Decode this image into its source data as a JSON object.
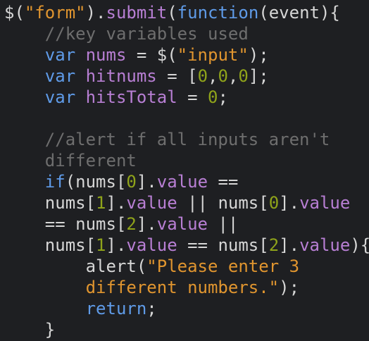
{
  "editor": {
    "language": "javascript",
    "colors": {
      "background": "#1e1f22",
      "string": "#e0952f",
      "function": "#b87fd4",
      "keyword": "#5f9be8",
      "number": "#8fa31a",
      "comment": "#6e6e6e",
      "plain": "#d6d6d6"
    },
    "lines": [
      [
        [
          "$(",
          "plain"
        ],
        [
          "\"form\"",
          "str"
        ],
        [
          ").",
          "plain"
        ],
        [
          "submit",
          "fn"
        ],
        [
          "(",
          "plain"
        ],
        [
          "function",
          "kw"
        ],
        [
          "(event){",
          "plain"
        ]
      ],
      [
        [
          "    ",
          "plain"
        ],
        [
          "//key variables used",
          "com"
        ]
      ],
      [
        [
          "    ",
          "plain"
        ],
        [
          "var",
          "kw"
        ],
        [
          " ",
          "plain"
        ],
        [
          "nums",
          "fn"
        ],
        [
          " = $(",
          "plain"
        ],
        [
          "\"input\"",
          "str"
        ],
        [
          ");",
          "plain"
        ]
      ],
      [
        [
          "    ",
          "plain"
        ],
        [
          "var",
          "kw"
        ],
        [
          " ",
          "plain"
        ],
        [
          "hitnums",
          "fn"
        ],
        [
          " = [",
          "plain"
        ],
        [
          "0",
          "num"
        ],
        [
          ",",
          "plain"
        ],
        [
          "0",
          "num"
        ],
        [
          ",",
          "plain"
        ],
        [
          "0",
          "num"
        ],
        [
          "];",
          "plain"
        ]
      ],
      [
        [
          "    ",
          "plain"
        ],
        [
          "var",
          "kw"
        ],
        [
          " ",
          "plain"
        ],
        [
          "hitsTotal",
          "fn"
        ],
        [
          " = ",
          "plain"
        ],
        [
          "0",
          "num"
        ],
        [
          ";",
          "plain"
        ]
      ],
      [
        [
          "",
          "plain"
        ]
      ],
      [
        [
          "    ",
          "plain"
        ],
        [
          "//alert if all inputs aren't",
          "com"
        ]
      ],
      [
        [
          "    ",
          "plain"
        ],
        [
          "different",
          "com"
        ]
      ],
      [
        [
          "    ",
          "plain"
        ],
        [
          "if",
          "kw"
        ],
        [
          "(nums[",
          "plain"
        ],
        [
          "0",
          "num"
        ],
        [
          "].",
          "plain"
        ],
        [
          "value",
          "fn"
        ],
        [
          " ==",
          "plain"
        ]
      ],
      [
        [
          "    nums[",
          "plain"
        ],
        [
          "1",
          "num"
        ],
        [
          "].",
          "plain"
        ],
        [
          "value",
          "fn"
        ],
        [
          " || nums[",
          "plain"
        ],
        [
          "0",
          "num"
        ],
        [
          "].",
          "plain"
        ],
        [
          "value",
          "fn"
        ]
      ],
      [
        [
          "    == nums[",
          "plain"
        ],
        [
          "2",
          "num"
        ],
        [
          "].",
          "plain"
        ],
        [
          "value",
          "fn"
        ],
        [
          " ||",
          "plain"
        ]
      ],
      [
        [
          "    nums[",
          "plain"
        ],
        [
          "1",
          "num"
        ],
        [
          "].",
          "plain"
        ],
        [
          "value",
          "fn"
        ],
        [
          " == nums[",
          "plain"
        ],
        [
          "2",
          "num"
        ],
        [
          "].",
          "plain"
        ],
        [
          "value",
          "fn"
        ],
        [
          "){",
          "plain"
        ]
      ],
      [
        [
          "        alert(",
          "plain"
        ],
        [
          "\"Please enter 3",
          "str"
        ]
      ],
      [
        [
          "        ",
          "plain"
        ],
        [
          "different numbers.\"",
          "str"
        ],
        [
          ");",
          "plain"
        ]
      ],
      [
        [
          "        ",
          "plain"
        ],
        [
          "return",
          "kw"
        ],
        [
          ";",
          "plain"
        ]
      ],
      [
        [
          "    }",
          "plain"
        ]
      ]
    ]
  }
}
